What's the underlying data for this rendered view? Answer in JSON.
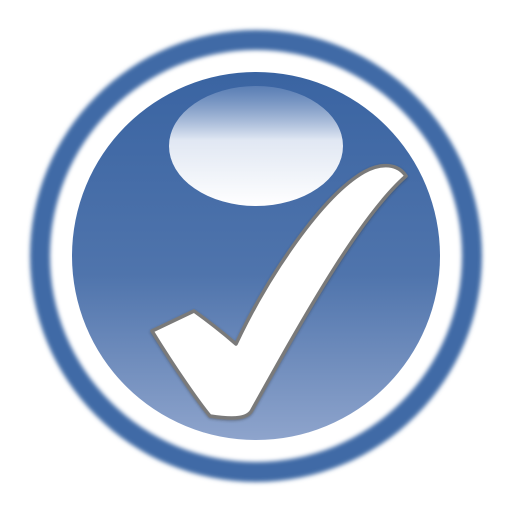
{
  "icon": {
    "name": "checkmark-icon",
    "colors": {
      "background": "#ffffff",
      "outer_ring": "#3f6aa6",
      "inner_ring": "#ffffff",
      "disc_top": "#3a64a2",
      "disc_bottom": "#7f98c4",
      "gloss": "#ffffff",
      "check_fill": "#ffffff",
      "check_stroke": "#7a7a7a"
    }
  }
}
